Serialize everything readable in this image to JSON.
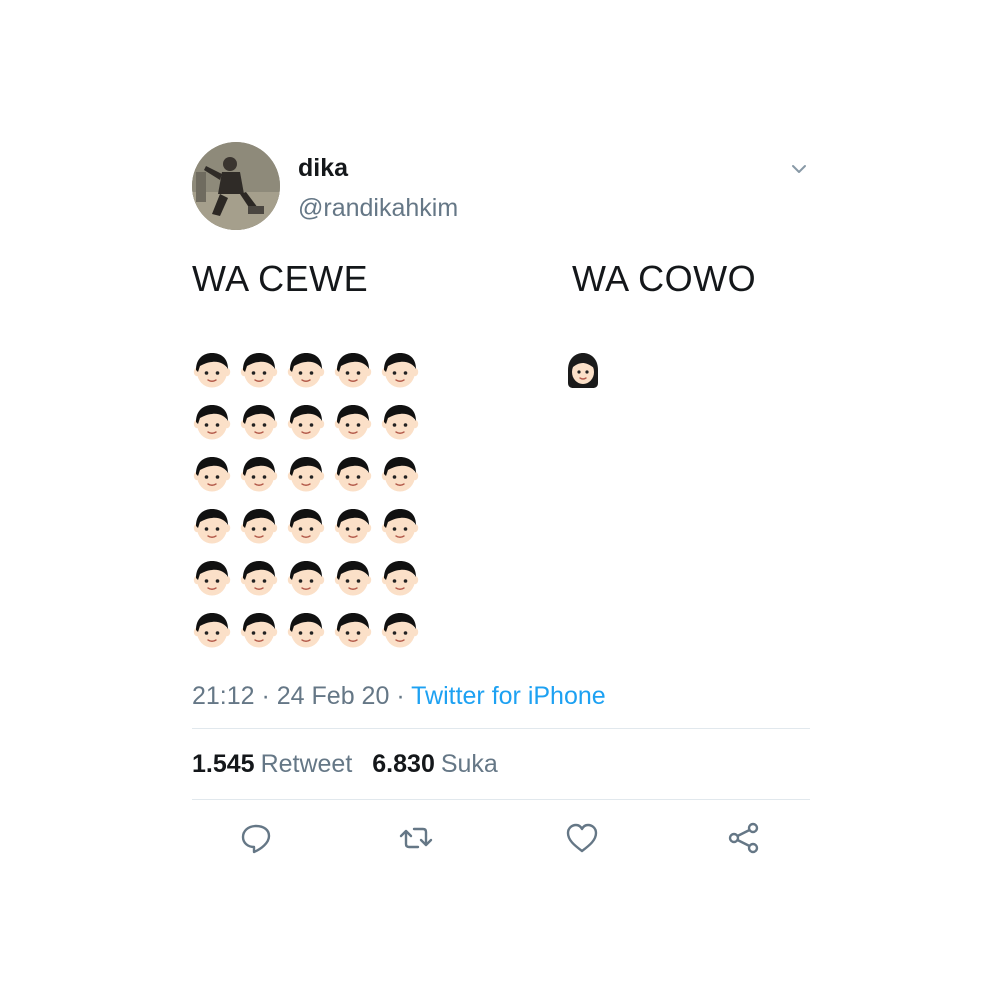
{
  "author": {
    "display_name": "dika",
    "handle": "@randikahkim"
  },
  "tweet": {
    "left_title": "WA CEWE",
    "right_title": "WA COWO",
    "left_emoji": "boy-face",
    "left_emoji_count": 30,
    "right_emoji": "girl-face",
    "right_emoji_count": 1
  },
  "meta": {
    "time": "21:12",
    "separator_1": " · ",
    "date": "24 Feb 20",
    "separator_2": " · ",
    "source": "Twitter for iPhone"
  },
  "stats": {
    "retweets_count": "1.545",
    "retweets_label": "Retweet",
    "likes_count": "6.830",
    "likes_label": "Suka"
  },
  "icons": {
    "caret": "chevron-down-icon",
    "reply": "reply-icon",
    "retweet": "retweet-icon",
    "like": "heart-icon",
    "share": "share-icon"
  },
  "colors": {
    "text": "#14171a",
    "secondary": "#657786",
    "link": "#1da1f2",
    "divider": "#e1e8ed"
  }
}
